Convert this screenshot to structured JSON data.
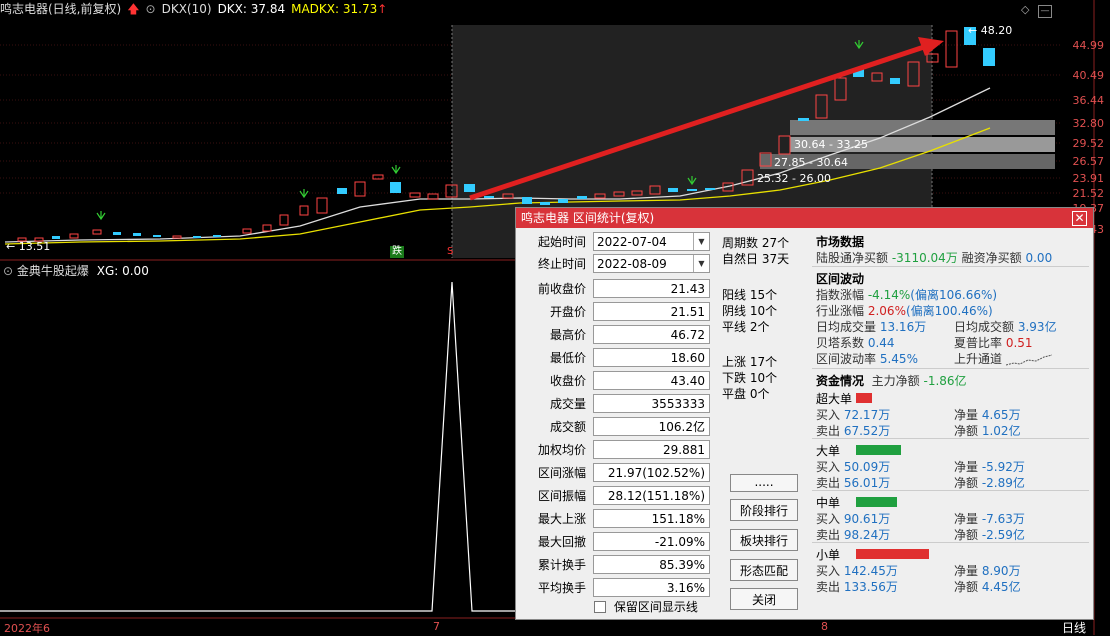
{
  "header": {
    "title": "鸣志电器(日线,前复权)",
    "ind_name": "DKX(10)",
    "dkx": "DKX: 37.84",
    "madkx": "MADKX: 31.73"
  },
  "price_axis": [
    "48.20",
    "44.99",
    "40.49",
    "36.44",
    "32.80",
    "29.52",
    "26.57",
    "23.91",
    "21.52",
    "19.37",
    "17.43"
  ],
  "chart_labels": {
    "high_mark": "48.20",
    "low_mark": "13.51",
    "zone1": "30.64 - 33.25",
    "zone2": "27.85 - 30.64",
    "zone3": "25.32 - 26.00",
    "die_mark": "跌",
    "s_mark": "S"
  },
  "lower_panel": {
    "title": "金典牛股起爆",
    "xg": "XG: 0.00"
  },
  "x_axis": [
    "2022年6",
    "7",
    "8"
  ],
  "period_tab": "日线",
  "dialog": {
    "title": "鸣志电器 区间统计(复权)",
    "start_label": "起始时间",
    "start_value": "2022-07-04",
    "end_label": "终止时间",
    "end_value": "2022-08-09",
    "fields": [
      {
        "label": "前收盘价",
        "value": "21.43"
      },
      {
        "label": "开盘价",
        "value": "21.51"
      },
      {
        "label": "最高价",
        "value": "46.72"
      },
      {
        "label": "最低价",
        "value": "18.60"
      },
      {
        "label": "收盘价",
        "value": "43.40"
      },
      {
        "label": "成交量",
        "value": "3553333"
      },
      {
        "label": "成交额",
        "value": "106.2亿"
      },
      {
        "label": "加权均价",
        "value": "29.881"
      },
      {
        "label": "区间涨幅",
        "value": "21.97(102.52%)"
      },
      {
        "label": "区间振幅",
        "value": "28.12(151.18%)"
      },
      {
        "label": "最大上涨",
        "value": "151.18%"
      },
      {
        "label": "最大回撤",
        "value": "-21.09%"
      },
      {
        "label": "累计换手",
        "value": "85.39%"
      },
      {
        "label": "平均换手",
        "value": "3.16%"
      }
    ],
    "stats": [
      "周期数 27个",
      "自然日 37天",
      "阳线 15个",
      "阴线 10个",
      "平线 2个",
      "上涨 17个",
      "下跌 10个",
      "平盘 0个"
    ],
    "buttons": {
      "dots": ".....",
      "rank": "阶段排行",
      "board": "板块排行",
      "pattern": "形态匹配",
      "close": "关闭"
    },
    "checkbox_label": "保留区间显示线",
    "market": {
      "title": "市场数据",
      "hk_label": "陆股通净买额",
      "hk_value": "-3110.04万",
      "margin_label": "融资净买额",
      "margin_value": "0.00"
    },
    "volatility": {
      "title": "区间波动",
      "index_label": "指数涨幅",
      "index_value": "-4.14%",
      "index_dev": "(偏离106.66%)",
      "industry_label": "行业涨幅",
      "industry_value": "2.06%",
      "industry_dev": "(偏离100.46%)",
      "avg_vol_label": "日均成交量",
      "avg_vol_value": "13.16万",
      "avg_amt_label": "日均成交额",
      "avg_amt_value": "3.93亿",
      "beta_label": "贝塔系数",
      "beta_value": "0.44",
      "sharpe_label": "夏普比率",
      "sharpe_value": "0.51",
      "vol_rate_label": "区间波动率",
      "vol_rate_value": "5.45%",
      "channel_label": "上升通道"
    },
    "funds": {
      "title": "资金情况",
      "main_label": "主力净额",
      "main_value": "-1.86亿",
      "groups": [
        {
          "name": "超大单",
          "buy": "72.17万",
          "sell": "67.52万",
          "netvol": "4.65万",
          "netamt": "1.02亿",
          "color": "#e03030",
          "bar": 0.28
        },
        {
          "name": "大单",
          "buy": "50.09万",
          "sell": "56.01万",
          "netvol": "-5.92万",
          "netamt": "-2.89亿",
          "color": "#20a040",
          "bar": 0.8
        },
        {
          "name": "中单",
          "buy": "90.61万",
          "sell": "98.24万",
          "netvol": "-7.63万",
          "netamt": "-2.59亿",
          "color": "#20a040",
          "bar": 0.73
        },
        {
          "name": "小单",
          "buy": "142.45万",
          "sell": "133.56万",
          "netvol": "8.90万",
          "netamt": "4.45亿",
          "color": "#e03030",
          "bar": 1.3
        }
      ],
      "buy_label": "买入",
      "sell_label": "卖出",
      "netvol_label": "净量",
      "netamt_label": "净额"
    }
  }
}
